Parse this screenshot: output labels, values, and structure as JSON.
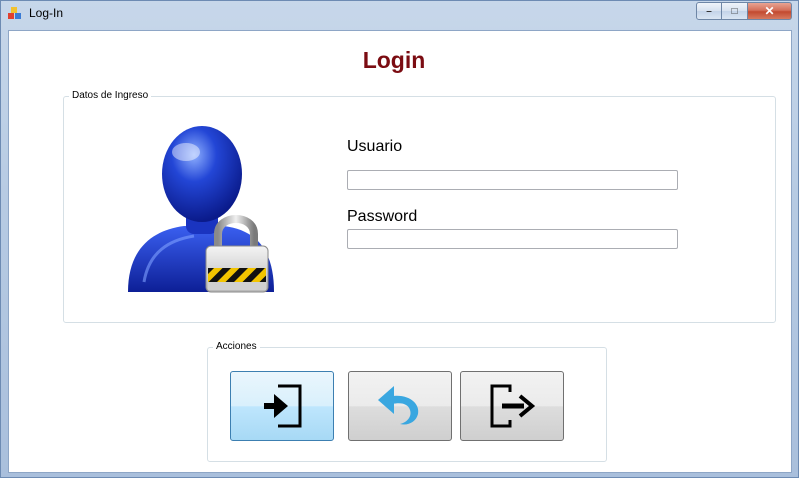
{
  "window": {
    "title": "Log-In",
    "controls": {
      "minimize": "–",
      "maximize": "□",
      "close": "✕"
    }
  },
  "page": {
    "title": "Login"
  },
  "datos_group": {
    "legend": "Datos de Ingreso",
    "user_label": "Usuario",
    "user_value": "",
    "password_label": "Password",
    "password_value": ""
  },
  "acciones_group": {
    "legend": "Acciones",
    "buttons": [
      {
        "icon": "enter-icon"
      },
      {
        "icon": "undo-arrow-icon"
      },
      {
        "icon": "exit-icon"
      }
    ]
  },
  "colors": {
    "title_color": "#7b0c12",
    "undo_arrow": "#3aa7e0"
  }
}
